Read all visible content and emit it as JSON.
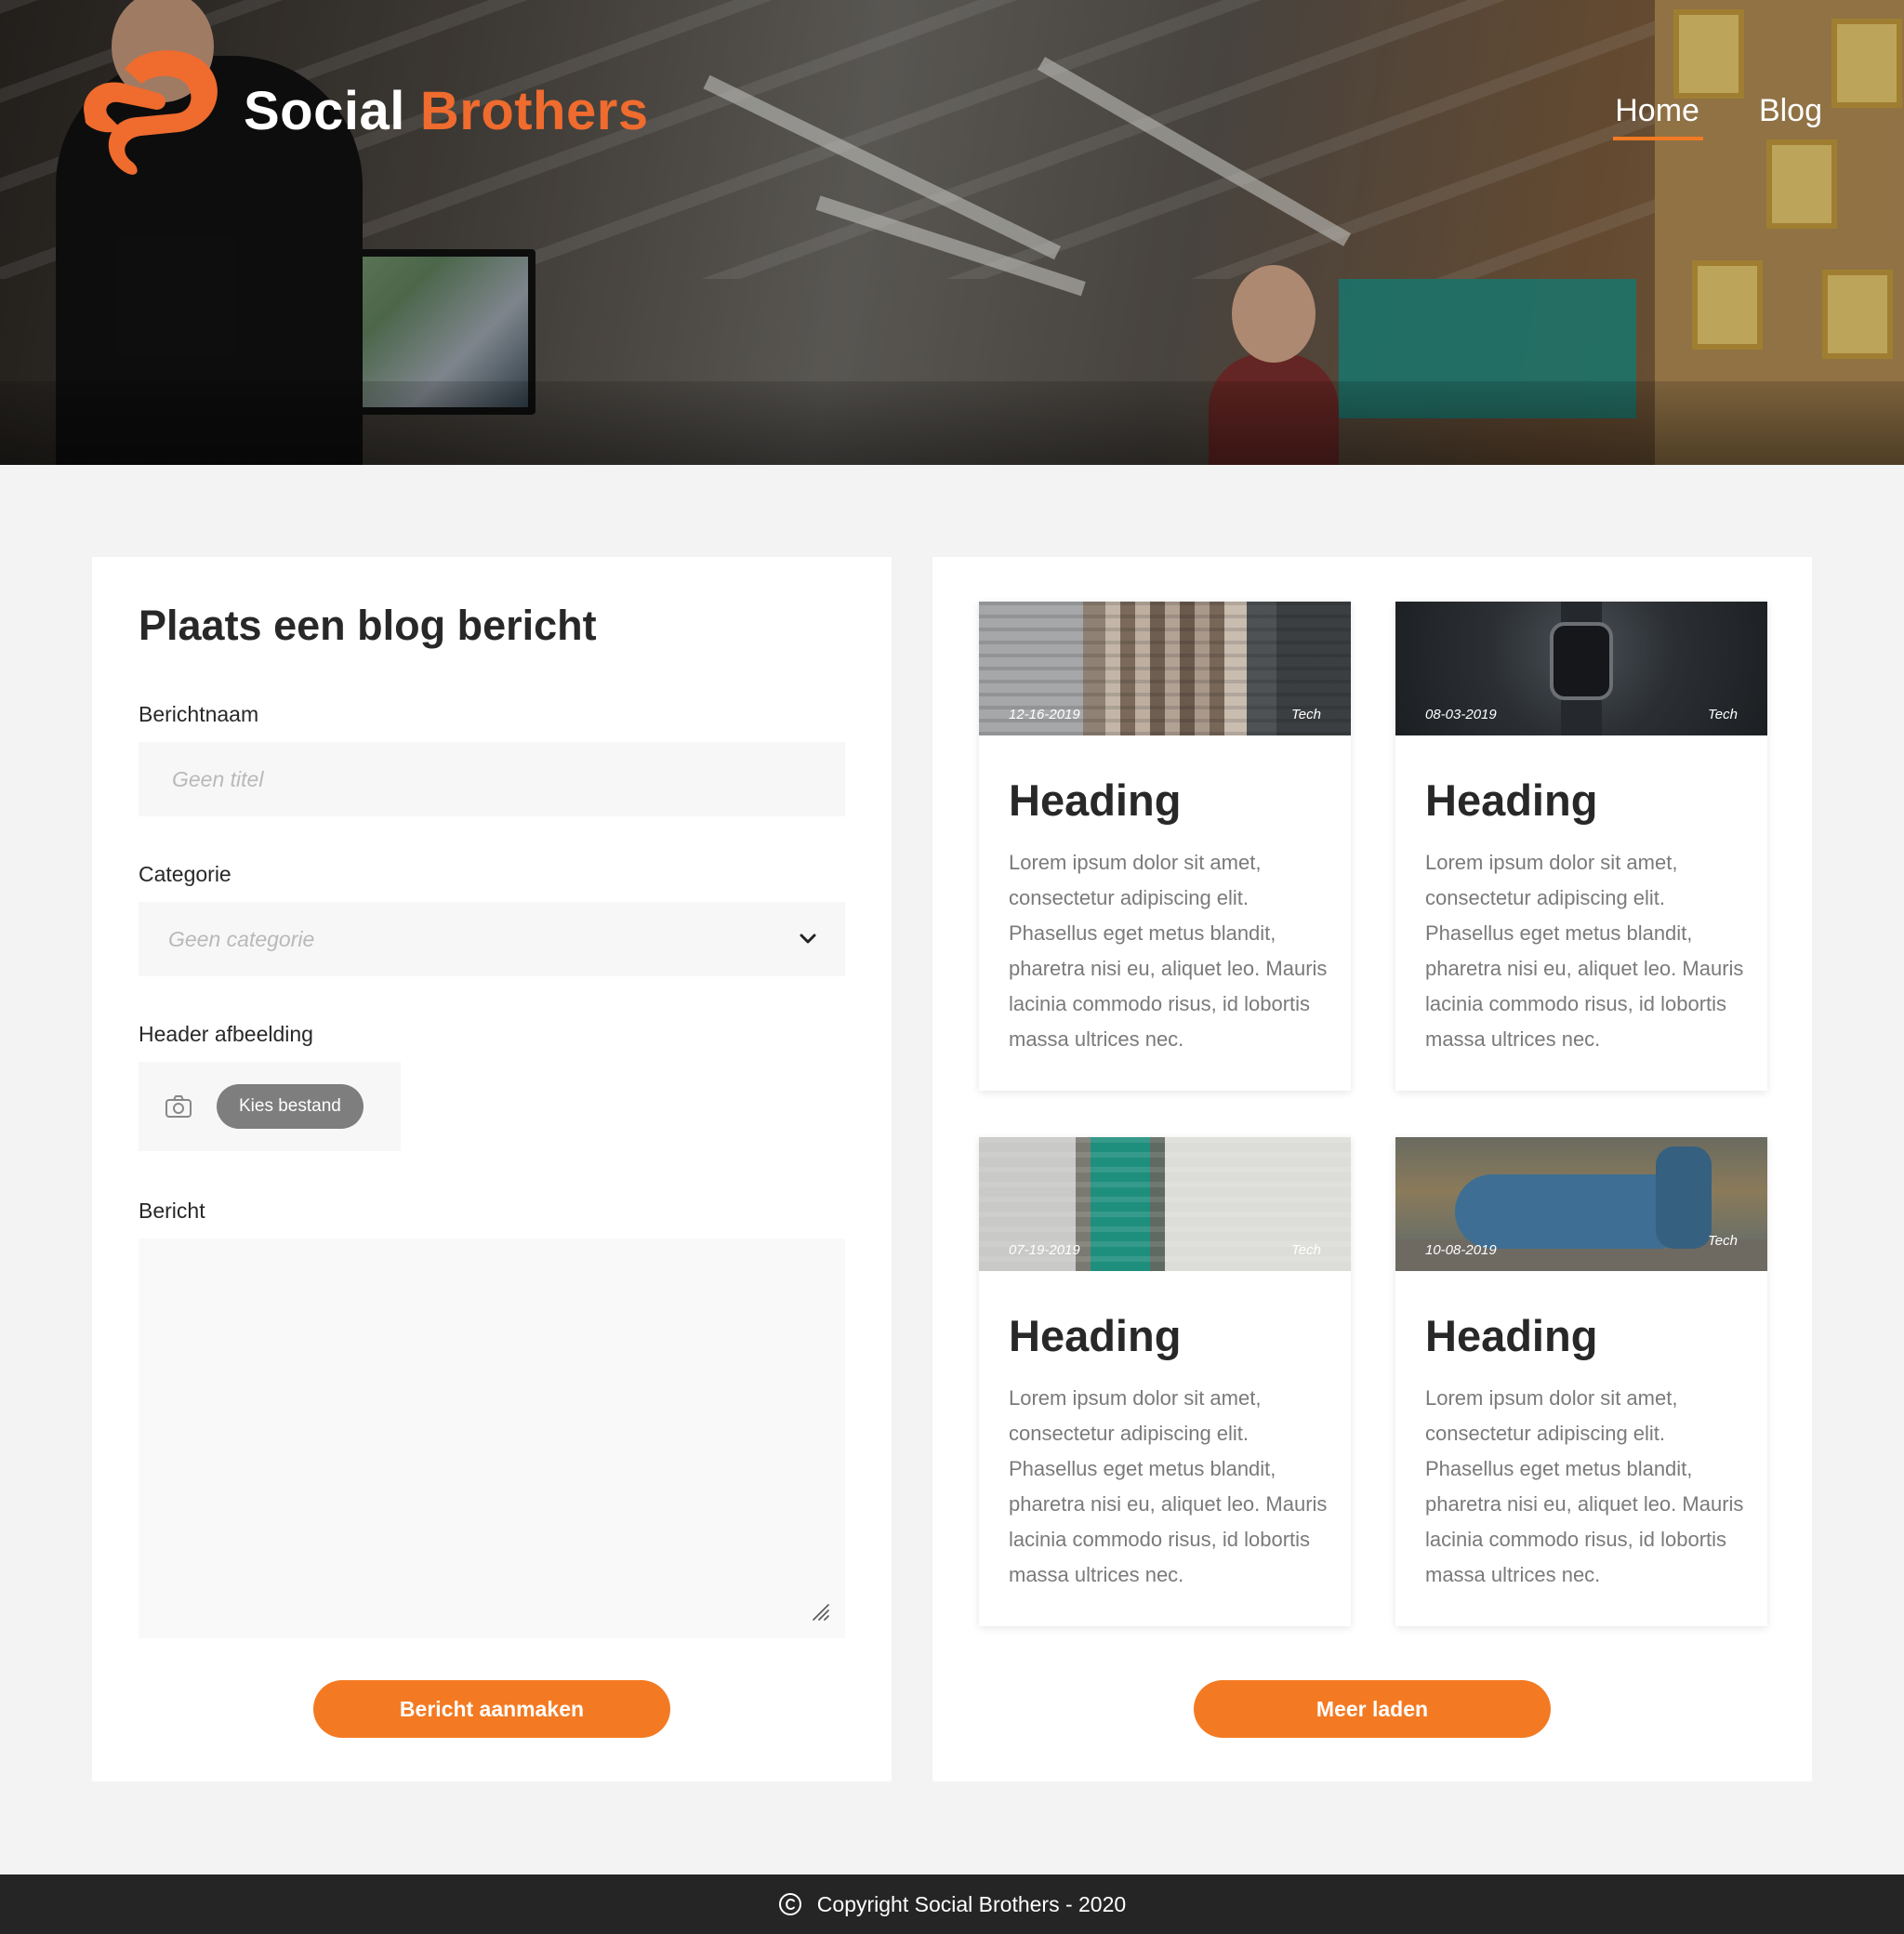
{
  "brand": {
    "name_white": "Social",
    "name_orange": "Brothers",
    "accent_color": "#ef6b2e"
  },
  "nav": {
    "items": [
      {
        "label": "Home",
        "active": true
      },
      {
        "label": "Blog",
        "active": false
      }
    ]
  },
  "form": {
    "title": "Plaats een blog bericht",
    "name_label": "Berichtnaam",
    "name_placeholder": "Geen titel",
    "category_label": "Categorie",
    "category_value": "Geen categorie",
    "image_label": "Header afbeelding",
    "file_button": "Kies bestand",
    "message_label": "Bericht",
    "submit_label": "Bericht aanmaken"
  },
  "blog": {
    "cards": [
      {
        "date": "12-16-2019",
        "category": "Tech",
        "heading": "Heading",
        "body": "Lorem ipsum dolor sit amet, consectetur adipiscing elit. Phasellus eget metus blandit, pharetra nisi eu, aliquet leo. Mauris lacinia commodo risus, id lobortis massa ultrices nec."
      },
      {
        "date": "08-03-2019",
        "category": "Tech",
        "heading": "Heading",
        "body": "Lorem ipsum dolor sit amet, consectetur adipiscing elit. Phasellus eget metus blandit, pharetra nisi eu, aliquet leo. Mauris lacinia commodo risus, id lobortis massa ultrices nec."
      },
      {
        "date": "07-19-2019",
        "category": "Tech",
        "heading": "Heading",
        "body": "Lorem ipsum dolor sit amet, consectetur adipiscing elit. Phasellus eget metus blandit, pharetra nisi eu, aliquet leo. Mauris lacinia commodo risus, id lobortis massa ultrices nec."
      },
      {
        "date": "10-08-2019",
        "category": "Tech",
        "heading": "Heading",
        "body": "Lorem ipsum dolor sit amet, consectetur adipiscing elit. Phasellus eget metus blandit, pharetra nisi eu, aliquet leo. Mauris lacinia commodo risus, id lobortis massa ultrices nec."
      }
    ],
    "load_more_label": "Meer laden"
  },
  "footer": {
    "copyright": "Copyright Social Brothers - 2020"
  },
  "icons": {
    "logo": "social-brothers-logo-icon",
    "select_arrow": "chevron-down-icon",
    "file": "camera-icon",
    "textarea": "resize-grip-icon",
    "footer": "copyright-icon"
  },
  "colors": {
    "primary_button": "#f37a22",
    "footer_bg": "#252525",
    "page_bg": "#f3f3f3"
  }
}
